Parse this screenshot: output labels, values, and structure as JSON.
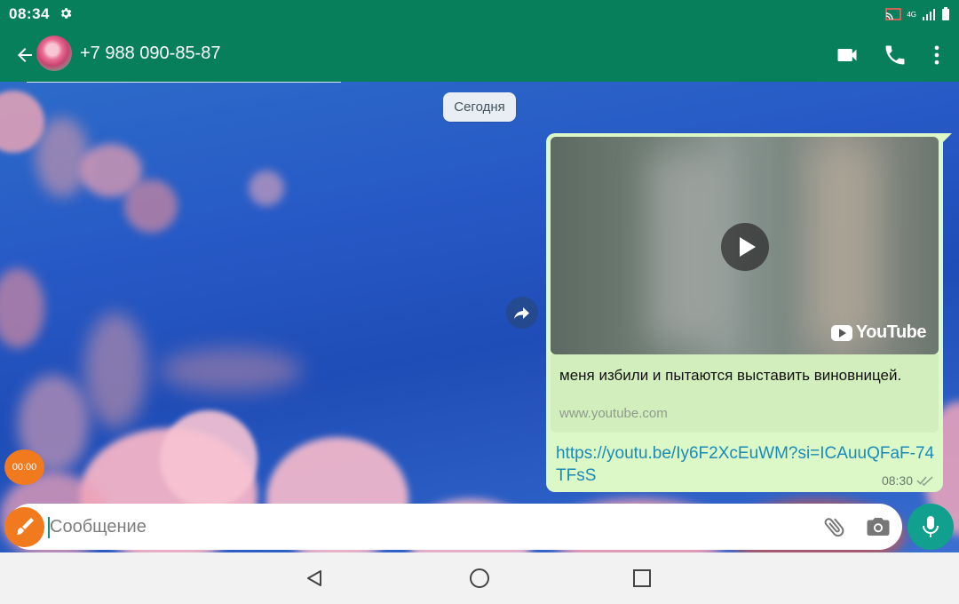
{
  "status_bar": {
    "time": "08:34",
    "network": "4G",
    "icons": [
      "settings-icon",
      "cast-icon",
      "signal-icon",
      "battery-icon"
    ]
  },
  "header": {
    "contact": "+7 988 090-85-87",
    "icons": [
      "back-arrow-icon",
      "video-call-icon",
      "phone-icon",
      "more-vert-icon"
    ]
  },
  "chat": {
    "date_chip": "Сегодня",
    "message": {
      "preview_brand": "YouTube",
      "link_title": "меня избили и пытаются выставить виновницей.",
      "link_host": "www.youtube.com",
      "url": "https://youtu.be/Iy6F2XcEuWM?si=ICAuuQFaF-74TFsS",
      "time": "08:30",
      "status": "delivered-double-check"
    }
  },
  "floating": {
    "timer": "00:00"
  },
  "composer": {
    "placeholder": "Сообщение",
    "value": ""
  },
  "colors": {
    "header": "#087f5b",
    "bubble": "#dcf8c6",
    "link": "#1a8bb8",
    "accent_orange": "#f07a1d",
    "mic": "#11a08d"
  }
}
